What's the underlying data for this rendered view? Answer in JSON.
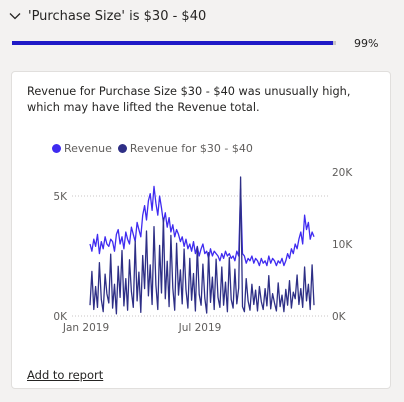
{
  "header": {
    "title": "'Purchase Size' is $30 - $40",
    "progress_label": "99%",
    "progress_value": 0.99
  },
  "card": {
    "description": "Revenue for Purchase Size $30 - $40 was unusually high, which may have lifted the Revenue total.",
    "add_link": "Add to report"
  },
  "colors": {
    "accent": "#1f1ac7",
    "series1": "#3f2bf0",
    "series2": "#2e2f86"
  },
  "chart_data": {
    "type": "line",
    "legend": [
      {
        "name": "Revenue",
        "color": "#3f2bf0"
      },
      {
        "name": "Revenue for $30 - $40",
        "color": "#2e2f86"
      }
    ],
    "x_ticks": [
      "Jan 2019",
      "Jul 2019"
    ],
    "y_left_ticks": [
      "0K",
      "5K"
    ],
    "y_right_ticks": [
      "0K",
      "10K",
      "20K"
    ],
    "y_left_range": [
      0,
      5500
    ],
    "y_right_range": [
      0,
      20000
    ],
    "series": [
      {
        "name": "Revenue",
        "axis": "left",
        "values": [
          3000,
          2700,
          3200,
          2900,
          3400,
          2600,
          3100,
          2800,
          3300,
          3000,
          2900,
          3200,
          3100,
          2700,
          3400,
          3600,
          3000,
          3300,
          2800,
          3500,
          3200,
          3000,
          3700,
          3400,
          3100,
          3900,
          3600,
          3300,
          4200,
          4600,
          4000,
          4800,
          5100,
          4400,
          5400,
          4700,
          4200,
          5000,
          4500,
          3900,
          4300,
          3700,
          4100,
          3500,
          3800,
          3300,
          3600,
          3400,
          3100,
          3300,
          2900,
          3200,
          2800,
          3000,
          2700,
          3100,
          2600,
          2900,
          2500,
          2800,
          3000,
          2600,
          2700,
          2400,
          2800,
          2500,
          2700,
          2600,
          2500,
          2300,
          2600,
          2400,
          2700,
          2500,
          2600,
          2400,
          2500,
          2300,
          2700,
          2500,
          5300,
          2600,
          2500,
          2200,
          2400,
          2300,
          2500,
          2200,
          2400,
          2300,
          2100,
          2400,
          2200,
          2300,
          2100,
          2500,
          2200,
          2400,
          2300,
          2100,
          2300,
          2200,
          2400,
          2100,
          2300,
          2600,
          2400,
          2800,
          2600,
          3000,
          2800,
          3200,
          3500,
          3000,
          4200,
          3600,
          3900,
          3200,
          3500,
          3300
        ]
      },
      {
        "name": "Revenue for $30 - $40",
        "axis": "right",
        "values": [
          1500,
          6200,
          900,
          4100,
          1200,
          7400,
          2300,
          600,
          5800,
          3100,
          1800,
          8600,
          1100,
          4400,
          300,
          6900,
          2600,
          9100,
          1400,
          5200,
          800,
          7800,
          3400,
          1200,
          10400,
          2100,
          6100,
          500,
          8400,
          3800,
          11800,
          2800,
          7100,
          1600,
          12400,
          4300,
          900,
          9800,
          3200,
          13600,
          2400,
          7600,
          1300,
          11200,
          3900,
          800,
          10100,
          2900,
          6400,
          1700,
          9300,
          3600,
          1100,
          8000,
          2200,
          5900,
          700,
          9600,
          3000,
          1500,
          7200,
          2500,
          400,
          8800,
          1900,
          5400,
          900,
          7900,
          2600,
          1200,
          6800,
          1500,
          4700,
          600,
          8100,
          2300,
          1100,
          6500,
          1700,
          3900,
          19300,
          1300,
          600,
          5200,
          2100,
          800,
          4400,
          1600,
          3600,
          700,
          4100,
          2000,
          900,
          3800,
          1400,
          5600,
          1000,
          3100,
          1800,
          700,
          4600,
          1300,
          2900,
          600,
          3700,
          1500,
          4900,
          1100,
          3300,
          2400,
          5700,
          1600,
          3800,
          1200,
          6800,
          2100,
          4400,
          900,
          7100,
          1500
        ]
      }
    ]
  }
}
